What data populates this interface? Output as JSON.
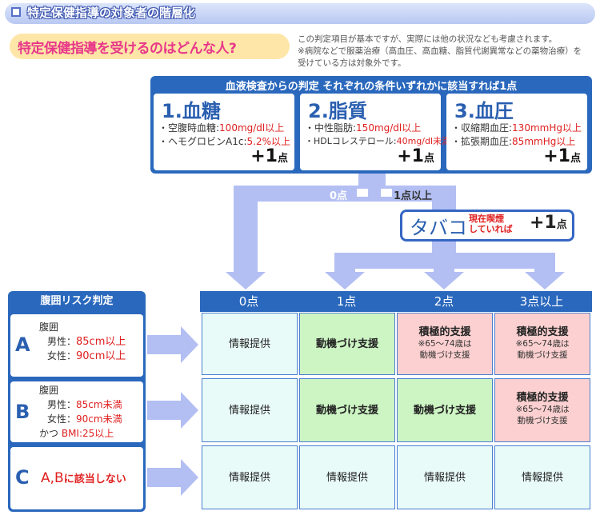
{
  "header": {
    "title": "特定保健指導の対象者の階層化"
  },
  "question": "特定保健指導を受けるのはどんな人?",
  "notes": [
    "この判定項目が基本ですが、実際には他の状況なども考慮されます。",
    "※病院などで服薬治療（高血圧、高血糖、脂質代謝異常などの薬物治療）を",
    "受けている方は対象外です。"
  ],
  "blood_test": {
    "title": "血液検査からの判定 それぞれの条件いずれかに該当すれば1点",
    "cards": [
      {
        "num": "1",
        "name": ".血糖",
        "l1a": "・空腹時血糖:",
        "l1b": "100mg/dl以上",
        "l2a": "・ヘモグロビンA1c:",
        "l2b": "5.2%以上",
        "pts": "+1",
        "unit": "点"
      },
      {
        "num": "2",
        "name": ".脂質",
        "l1a": "・中性脂肪:",
        "l1b": "150mg/dl以上",
        "l2a": "・HDLコレステロール:",
        "l2b": "40mg/dl未満",
        "pts": "+1",
        "unit": "点"
      },
      {
        "num": "3",
        "name": ".血圧",
        "l1a": "・収縮期血圧:",
        "l1b": "130mmHg以上",
        "l2a": "・拡張期血圧:",
        "l2b": "85mmHg以上",
        "pts": "+1",
        "unit": "点"
      }
    ]
  },
  "branch": {
    "zero": "0点",
    "one_plus": "1点以上"
  },
  "tobacco": {
    "label": "タバコ",
    "note1": "現在喫煙",
    "note2": "していれば",
    "pts": "+1",
    "unit": "点"
  },
  "grid": {
    "columns": [
      "0点",
      "1点",
      "2点",
      "3点以上"
    ],
    "info": "情報提供",
    "motivation": "動機づけ支援",
    "active": "積極的支援",
    "active_note1": "※65～74歳は",
    "active_note2": "動機づけ支援"
  },
  "risk": {
    "title": "腹囲リスク判定",
    "A": {
      "letter": "A",
      "l1": "腹囲",
      "l2a": "男性：",
      "l2b": "85cm以上",
      "l3a": "女性：",
      "l3b": "90cm以上"
    },
    "B": {
      "letter": "B",
      "l1": "腹囲",
      "l2a": "男性：",
      "l2b": "85cm未満",
      "l3a": "女性：",
      "l3b": "90cm未満",
      "l4a": "かつ",
      "l4b": "BMI:25以上"
    },
    "C": {
      "letter": "C",
      "l1a": "A,B",
      "l1b": "に該当しない"
    }
  },
  "colors": {
    "blue": "#2a68bd",
    "arrow": "#b3bff3",
    "pink": "#e8378a",
    "red": "#e02020"
  }
}
